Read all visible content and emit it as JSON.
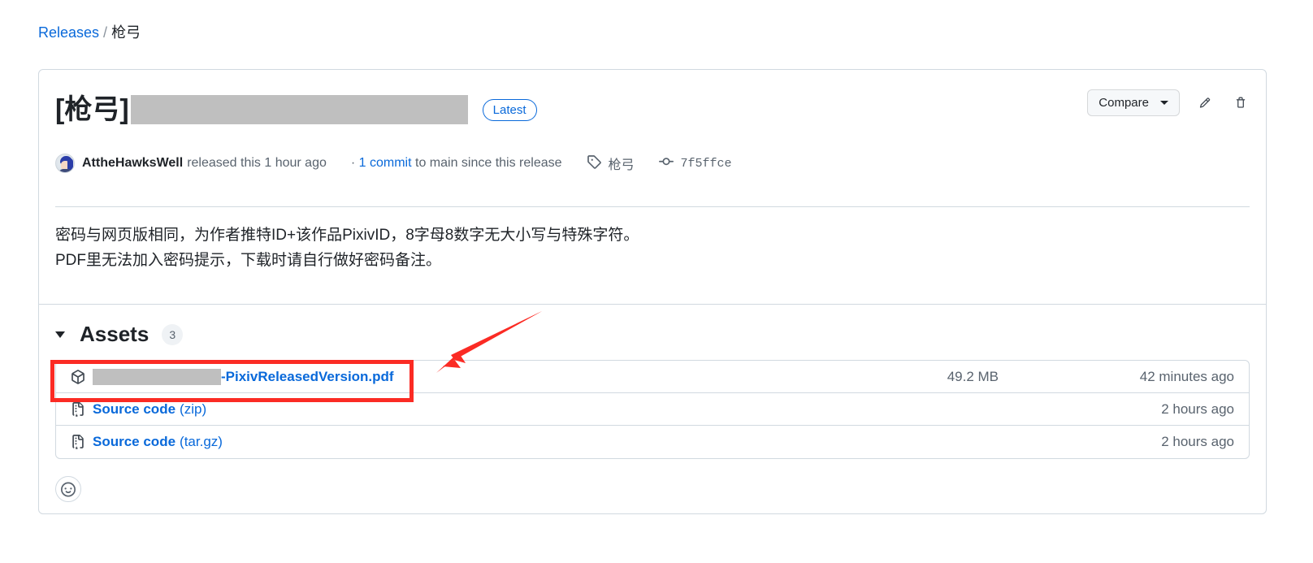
{
  "breadcrumb": {
    "root_label": "Releases",
    "separator": "/",
    "current_label": "枪弓"
  },
  "release": {
    "title": "[枪弓]",
    "title_redacted": true,
    "latest_badge": "Latest",
    "actions": {
      "compare_label": "Compare",
      "caret_icon": "chevron-down-icon",
      "edit_icon": "pencil-icon",
      "delete_icon": "trash-icon"
    },
    "byline": {
      "author": "AttheHawksWell",
      "released_text": "released this 1 hour ago",
      "commit_prefix": "·",
      "commit_link": "1 commit",
      "commit_suffix": "to main since this release",
      "tag_icon": "tag-icon",
      "tag_name": "枪弓",
      "commit_icon": "git-commit-icon",
      "commit_hash": "7f5ffce"
    },
    "body_lines": [
      "密码与网页版相同，为作者推特ID+该作品PixivID，8字母8数字无大小写与特殊字符。",
      "PDF里无法加入密码提示，下载时请自行做好密码备注。"
    ]
  },
  "assets": {
    "caret_icon": "triangle-down-icon",
    "title": "Assets",
    "count": "3",
    "columns": [
      "name",
      "size",
      "date"
    ],
    "rows": [
      {
        "icon": "package-icon",
        "name_redacted": true,
        "name": "-PixivReleasedVersion.pdf",
        "name_sub": "",
        "size": "49.2 MB",
        "date": "42 minutes ago",
        "highlighted": true
      },
      {
        "icon": "file-zip-icon",
        "name_redacted": false,
        "name": "Source code",
        "name_sub": "(zip)",
        "size": "",
        "date": "2 hours ago",
        "highlighted": false
      },
      {
        "icon": "file-zip-icon",
        "name_redacted": false,
        "name": "Source code",
        "name_sub": "(tar.gz)",
        "size": "",
        "date": "2 hours ago",
        "highlighted": false
      }
    ]
  },
  "reaction": {
    "icon": "smiley-icon"
  },
  "annotations": {
    "highlight_color": "#fb2b24",
    "arrow_color": "#fb2b24",
    "box_target": "first-asset-row",
    "arrow_points_to": "first-asset-row"
  },
  "colors": {
    "link": "#0969da",
    "text": "#1f2328",
    "muted": "#59636e",
    "border": "#d1d9e0",
    "redaction": "#bfbfbf",
    "annotation": "#fb2b24"
  }
}
